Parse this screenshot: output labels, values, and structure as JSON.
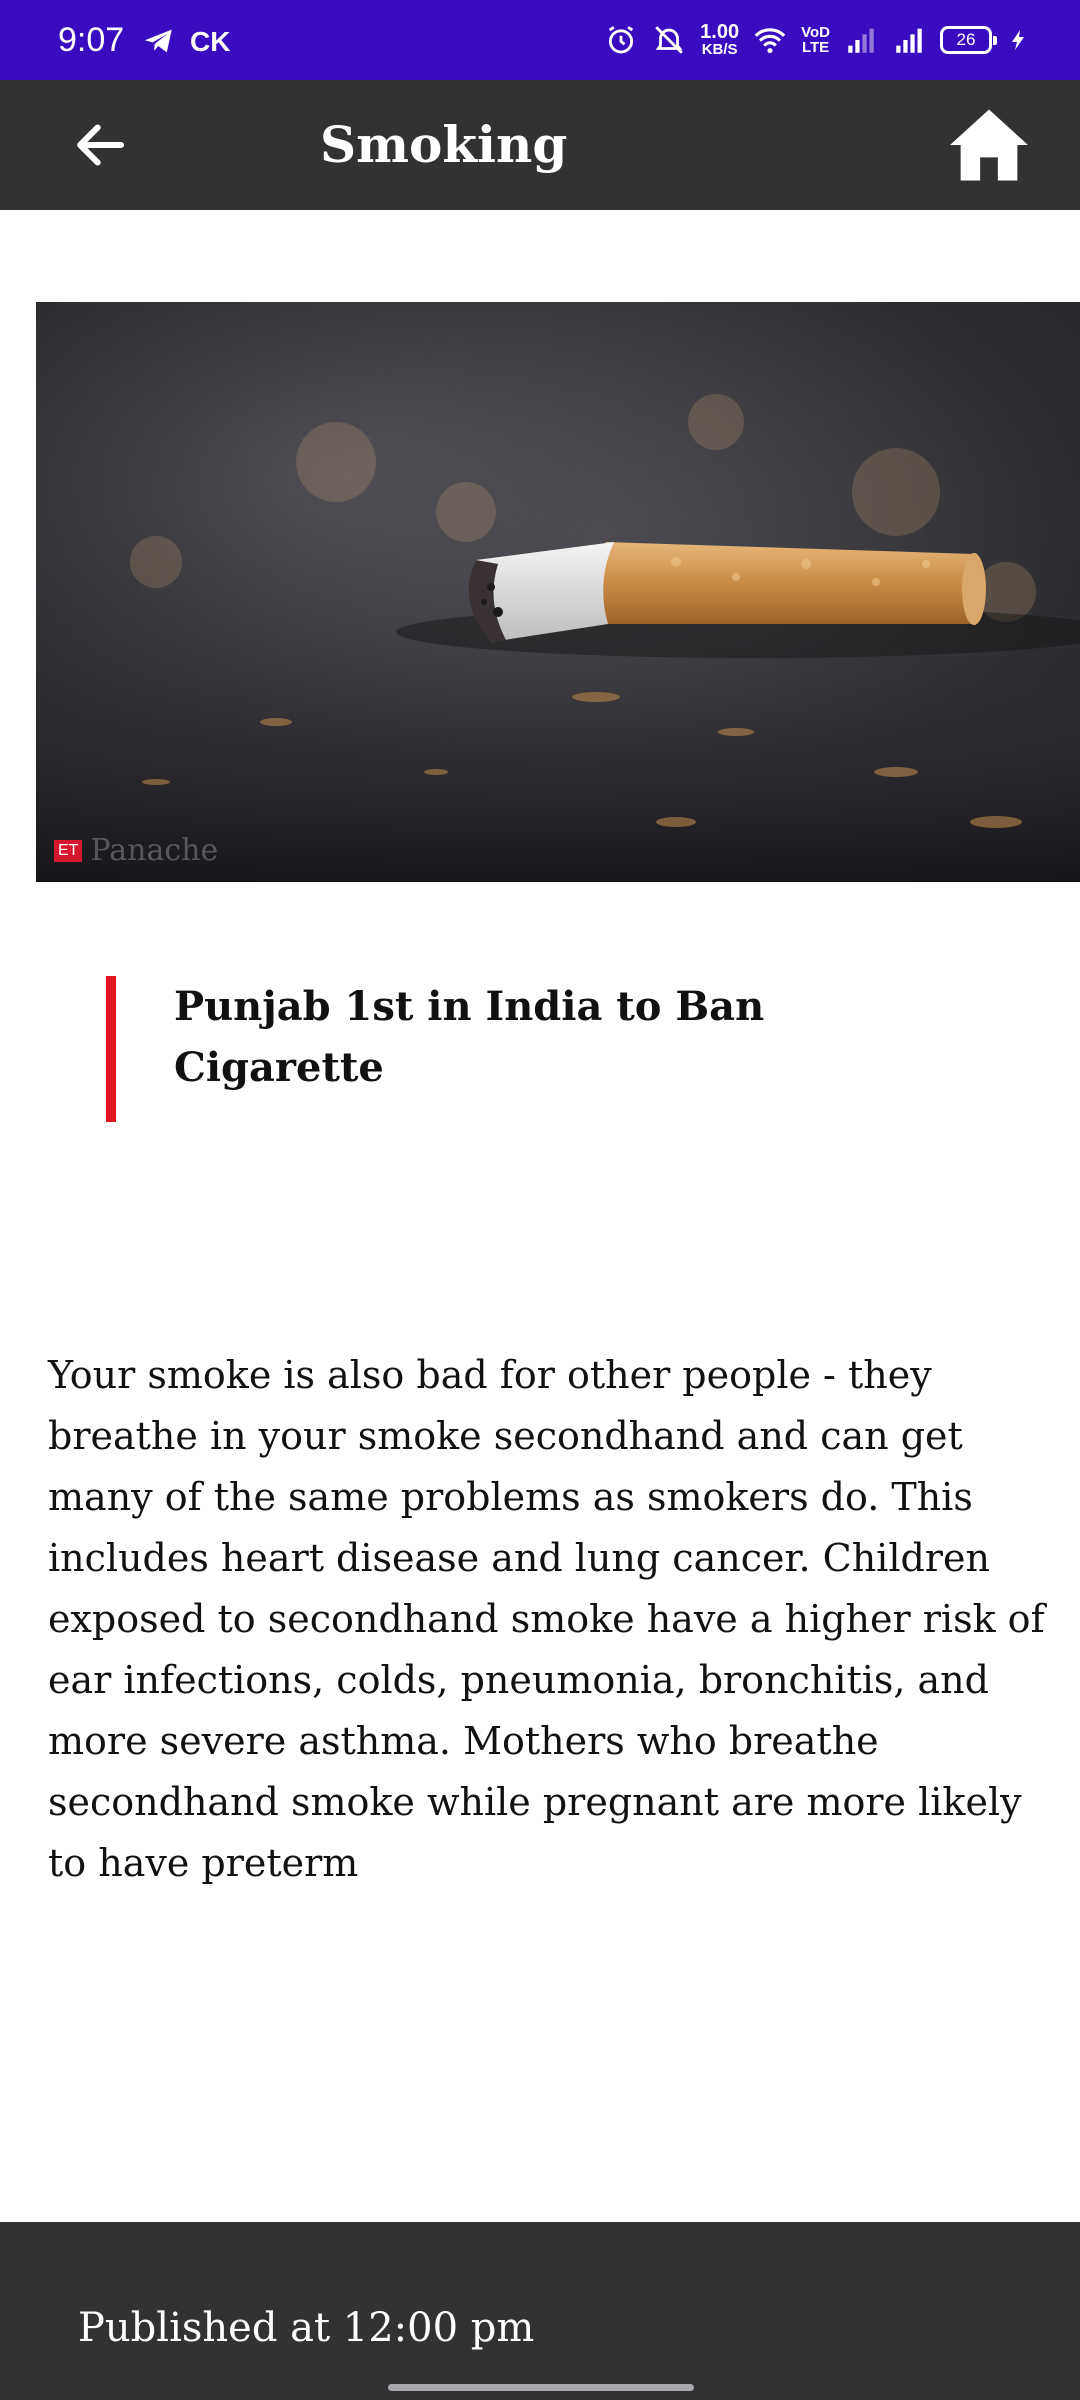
{
  "status_bar": {
    "time": "9:07",
    "carrier": "CK",
    "net_speed_value": "1.00",
    "net_speed_unit": "KB/S",
    "volte_top": "VoD",
    "volte_bottom": "LTE",
    "battery": "26",
    "background_color": "#3a0cbf"
  },
  "app_bar": {
    "title": "Smoking",
    "back_icon": "arrow-left-icon",
    "home_icon": "home-icon",
    "background_color": "#323234"
  },
  "hero_image": {
    "description_icon": "cigarette-butt-photo",
    "watermark_badge": "ET",
    "watermark_text": "Panache"
  },
  "article": {
    "headline": "Punjab 1st in India to Ban Cigarette",
    "accent_color": "#e1151f",
    "body": "Your smoke is also bad for other people - they breathe in your smoke secondhand and can get many of the same problems as smokers do. This includes heart disease and lung cancer. Children exposed to secondhand smoke have a higher risk of ear infections, colds, pneumonia, bronchitis, and more severe asthma. Mothers who breathe secondhand smoke while pregnant are more likely to have preterm"
  },
  "footer": {
    "published": "Published at 12:00 pm"
  }
}
